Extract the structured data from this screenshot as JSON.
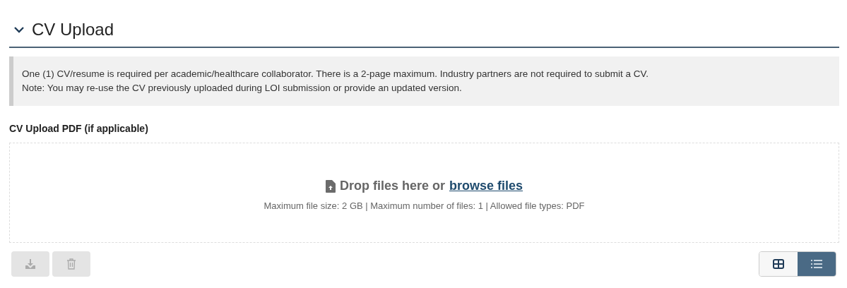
{
  "section": {
    "title": "CV Upload",
    "expanded": true
  },
  "note": [
    "One (1) CV/resume is required per academic/healthcare collaborator. There is a 2-page maximum. Industry partners are not required to submit a CV.",
    "Note: You may re-use the CV previously uploaded during LOI submission or provide an updated version."
  ],
  "field_label": "CV Upload PDF (if applicable)",
  "dropzone": {
    "prompt": "Drop files here or",
    "link": "browse files",
    "limits": "Maximum file size: 2 GB | Maximum number of files: 1 | Allowed file types: PDF"
  },
  "actions": [
    {
      "kind": "download",
      "disabled": true
    },
    {
      "kind": "delete",
      "disabled": true
    }
  ],
  "view_toggle": [
    {
      "kind": "grid",
      "selected": false
    },
    {
      "kind": "list",
      "selected": true
    }
  ]
}
